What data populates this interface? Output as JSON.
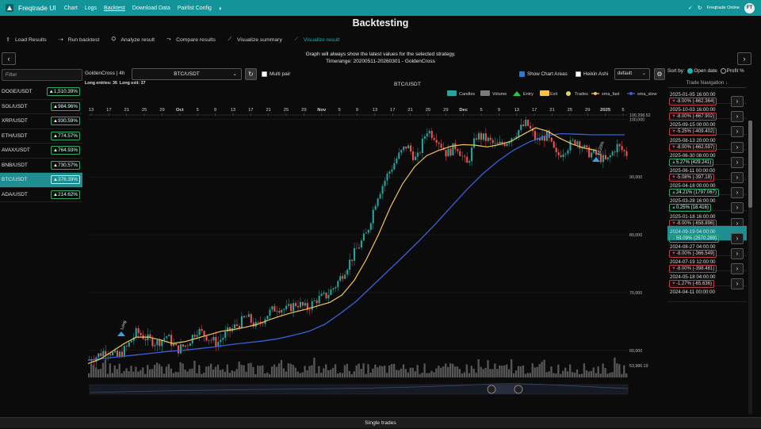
{
  "app": {
    "brand": "Freqtrade UI",
    "online_label": "Freqtrade Online",
    "avatar": "FT"
  },
  "nav": [
    "Chart",
    "Logs",
    "Backtest",
    "Download Data",
    "Pairlist Config"
  ],
  "page_title": "Backtesting",
  "tabs": [
    {
      "label": "Load Results",
      "icon": "upload-icon"
    },
    {
      "label": "Run backtest",
      "icon": "run-icon"
    },
    {
      "label": "Analyze result",
      "icon": "analyze-icon"
    },
    {
      "label": "Compare results",
      "icon": "compare-icon"
    },
    {
      "label": "Visualize summary",
      "icon": "chart-line-icon"
    },
    {
      "label": "Visualize result",
      "icon": "chart-line-icon"
    }
  ],
  "info": {
    "line1": "Graph will always show the latest values for the selected strategy.",
    "line2": "Timerange: 20200511-20260301 - GoldenCross"
  },
  "pair_filter_placeholder": "Filter",
  "pairs": [
    {
      "name": "DOGE/USDT",
      "profit": "1,510.39%"
    },
    {
      "name": "SOL/USDT",
      "profit": "984.96%"
    },
    {
      "name": "XRP/USDT",
      "profit": "930.59%"
    },
    {
      "name": "ETH/USDT",
      "profit": "774.57%"
    },
    {
      "name": "AVAX/USDT",
      "profit": "764.93%"
    },
    {
      "name": "BNB/USDT",
      "profit": "730.57%"
    },
    {
      "name": "BTC/USDT",
      "profit": "376.39%"
    },
    {
      "name": "ADA/USDT",
      "profit": "214.62%"
    }
  ],
  "toolbar": {
    "strategy": "GoldenCross | 4h",
    "pair": "BTC/USDT",
    "multi_pair": "Multi pair",
    "long_entries": "Long entries: 36",
    "long_exit": "Long exit: 37",
    "show_chart_areas": "Show Chart Areas",
    "heikin_ashi": "Heikin Ashi",
    "theme": "default"
  },
  "chart_data": {
    "type": "line",
    "title": "BTC/USDT",
    "legend": [
      "Candles",
      "Volume",
      "Entry",
      "Exit",
      "Trades",
      "sma_fast",
      "sma_slow"
    ],
    "legend_colors": [
      "#26a69a",
      "#7a7a7a",
      "#27c93f",
      "#f3c649",
      "#d6d66b",
      "#f1c35c",
      "#3b5fd6"
    ],
    "x_ticks": [
      "13",
      "17",
      "21",
      "25",
      "29",
      "Oct",
      "5",
      "9",
      "13",
      "17",
      "21",
      "25",
      "29",
      "Nov",
      "5",
      "9",
      "13",
      "17",
      "21",
      "25",
      "29",
      "Dec",
      "5",
      "9",
      "13",
      "17",
      "21",
      "25",
      "29",
      "2025",
      "5"
    ],
    "y_ticks": [
      "100,398.52",
      "100,000",
      "90,000",
      "80,000",
      "70,000",
      "60,000"
    ],
    "volume_label": "53,986.19",
    "ylim": [
      56000,
      101000
    ],
    "x_steps": 30,
    "price_path": [
      58300,
      59000,
      60200,
      58800,
      60500,
      63200,
      62000,
      61300,
      62500,
      60100,
      61000,
      63600,
      62400,
      61200,
      63000,
      64300,
      65800,
      64000,
      66200,
      67500,
      67000,
      68200,
      67200,
      68800,
      69500,
      71500,
      74500,
      77500,
      80200,
      86500,
      90100,
      93200,
      95500,
      92800,
      98200,
      96800,
      94000,
      95500,
      92000,
      97200,
      96500,
      95300,
      96200,
      97800,
      99300,
      96200,
      97200,
      93500,
      95100,
      96500,
      94300,
      93800,
      92600,
      95400,
      94000
    ],
    "sma_fast": [
      57700,
      58500,
      59800,
      61200,
      62300,
      62300,
      61800,
      61200,
      61500,
      62100,
      62700,
      63300,
      63600,
      64000,
      64500,
      65300,
      66000,
      66600,
      67100,
      67700,
      68300,
      69600,
      72100,
      75700,
      80000,
      84800,
      88800,
      91800,
      93700,
      94600,
      95300,
      95600,
      95500,
      95200,
      95600,
      96200,
      97400,
      98500,
      97900,
      96700,
      95700,
      95000,
      94600
    ],
    "sma_slow": [
      58300,
      58600,
      58900,
      59200,
      59500,
      59800,
      60000,
      60300,
      60600,
      61000,
      61300,
      61600,
      62000,
      62600,
      63300,
      64500,
      66400,
      68500,
      71100,
      73700,
      76300,
      79000,
      81800,
      84800,
      87800,
      90500,
      92800,
      94700,
      96100,
      97100,
      97500,
      97400,
      97300
    ],
    "trade_labels": [
      "Long",
      "10.20%"
    ]
  },
  "right_panel": {
    "sort_by": "Sort by:",
    "open_date": "Open date",
    "profit_pct": "Profit %",
    "trade_nav": "Trade Navigation",
    "trades": [
      {
        "date": "2025-01-05 16:00:00",
        "pnl": "-8.00% (-662.364)",
        "win": false
      },
      {
        "date": "2025-10-03 16:00:00",
        "pnl": "-8.00% (-667.902)",
        "win": false
      },
      {
        "date": "2025-09-15 00:00:00",
        "pnl": "-5.25% (-409.402)",
        "win": false
      },
      {
        "date": "2025-08-13 20:00:00",
        "pnl": "-8.00% (-662.597)",
        "win": false
      },
      {
        "date": "2025-06-30 08:00:00",
        "pnl": "5.27% (429.241)",
        "win": true
      },
      {
        "date": "2025-06-11 00:00:00",
        "pnl": "-5.08% (-397.18)",
        "win": false
      },
      {
        "date": "2025-04-18 00:00:00",
        "pnl": "24.21% (1797.067)",
        "win": true
      },
      {
        "date": "2025-03-28 16:00:00",
        "pnl": "0.25% (18.416)",
        "win": true
      },
      {
        "date": "2025-01-18 16:00:00",
        "pnl": "-8.00% (-658.896)",
        "win": false
      },
      {
        "date": "2024-09-19 04:00:00",
        "pnl": "59.09% (2570.289)",
        "win": true
      },
      {
        "date": "2024-08-27 04:00:00",
        "pnl": "-8.00% (-366.549)",
        "win": false
      },
      {
        "date": "2024-07-19 12:00:00",
        "pnl": "-8.00% (-398.481)",
        "win": false
      },
      {
        "date": "2024-05-18 04:00:00",
        "pnl": "-1.27% (-65.636)",
        "win": false
      },
      {
        "date": "2024-04-11 00:00:00",
        "pnl": "",
        "win": false
      }
    ]
  },
  "footer": "Single trades"
}
